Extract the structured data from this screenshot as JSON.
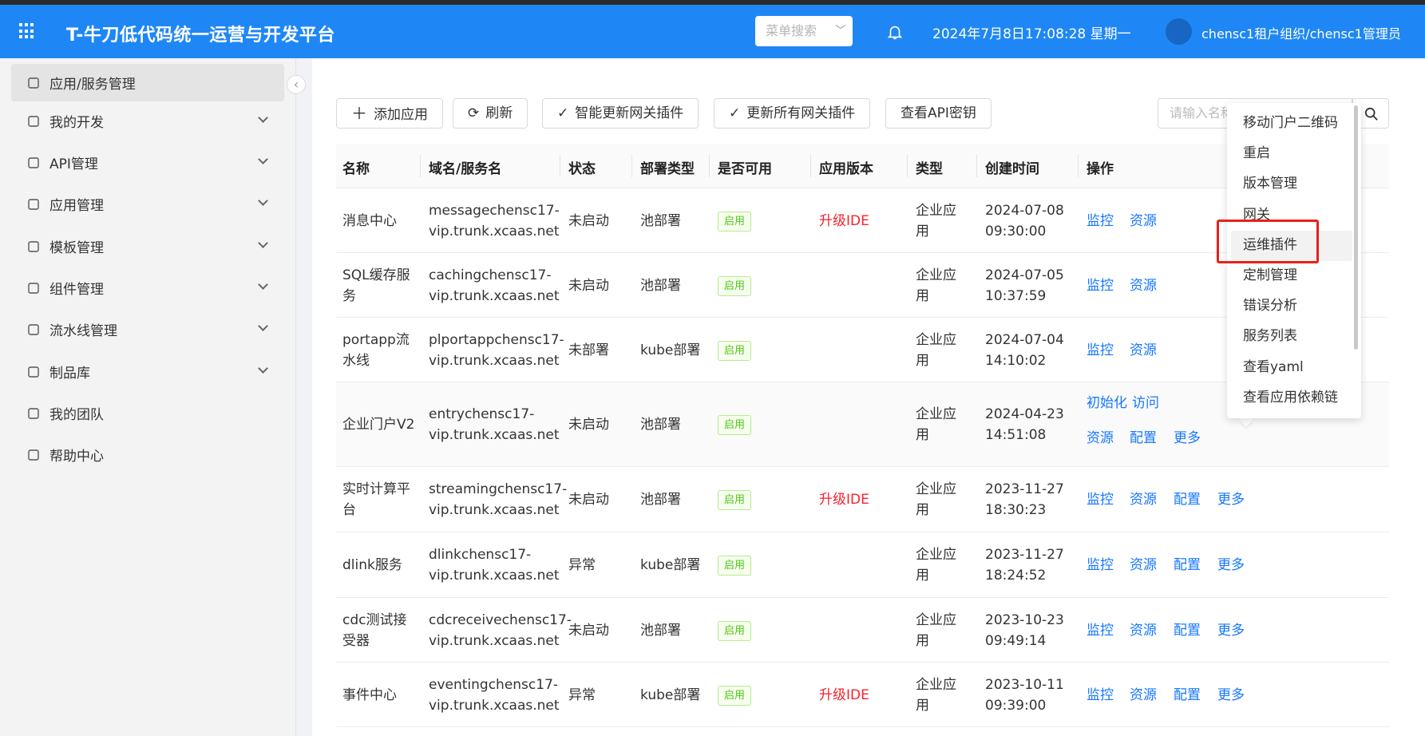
{
  "header": {
    "title": "T-牛刀低代码统一运营与开发平台",
    "menu_search": "菜单搜索",
    "datetime": "2024年7月8日17:08:28 星期一",
    "user": "chensc1租户组织/chensc1管理员"
  },
  "sidebar": {
    "items": [
      {
        "label": "应用/服务管理",
        "icon": "app-service-icon"
      },
      {
        "label": "我的开发",
        "icon": "dev-icon"
      },
      {
        "label": "API管理",
        "icon": "api-icon"
      },
      {
        "label": "应用管理",
        "icon": "grid-icon"
      },
      {
        "label": "模板管理",
        "icon": "template-icon"
      },
      {
        "label": "组件管理",
        "icon": "component-icon"
      },
      {
        "label": "流水线管理",
        "icon": "folder-icon"
      },
      {
        "label": "制品库",
        "icon": "folder-icon"
      },
      {
        "label": "我的团队",
        "icon": "team-icon"
      },
      {
        "label": "帮助中心",
        "icon": "help-icon"
      }
    ]
  },
  "toolbar": {
    "add": "添加应用",
    "refresh": "刷新",
    "smart_update": "智能更新网关插件",
    "update_all": "更新所有网关插件",
    "view_api_key": "查看API密钥",
    "search_placeholder": "请输入名称"
  },
  "table": {
    "headers": [
      "名称",
      "域名/服务名",
      "状态",
      "部署类型",
      "是否可用",
      "应用版本",
      "类型",
      "创建时间",
      "操作"
    ],
    "rows": [
      {
        "name": [
          "消息中心"
        ],
        "domain": [
          "messagechensc17-",
          "vip.trunk.xcaas.net"
        ],
        "status": "未启动",
        "deploy": "池部署",
        "avail": "启用",
        "version": "升级IDE",
        "type": [
          "企业应",
          "用"
        ],
        "created": [
          "2024-07-08",
          "09:30:00"
        ],
        "ops": [
          "监控",
          "资源"
        ]
      },
      {
        "name": [
          "SQL缓存服",
          "务"
        ],
        "domain": [
          "cachingchensc17-",
          "vip.trunk.xcaas.net"
        ],
        "status": "未启动",
        "deploy": "池部署",
        "avail": "启用",
        "version": "",
        "type": [
          "企业应",
          "用"
        ],
        "created": [
          "2024-07-05",
          "10:37:59"
        ],
        "ops": [
          "监控",
          "资源"
        ]
      },
      {
        "name": [
          "portapp流",
          "水线"
        ],
        "domain": [
          "plportappchensc17-",
          "vip.trunk.xcaas.net"
        ],
        "status": "未部署",
        "deploy": "kube部署",
        "avail": "启用",
        "version": "",
        "type": [
          "企业应",
          "用"
        ],
        "created": [
          "2024-07-04",
          "14:10:02"
        ],
        "ops": [
          "监控",
          "资源"
        ]
      },
      {
        "name": [
          "企业门户V2"
        ],
        "domain": [
          "entrychensc17-",
          "vip.trunk.xcaas.net"
        ],
        "status": "未启动",
        "deploy": "池部署",
        "avail": "启用",
        "version": "",
        "type": [
          "企业应",
          "用"
        ],
        "created": [
          "2024-04-23",
          "14:51:08"
        ],
        "ops": [
          "初始化",
          "访问",
          "资源",
          "配置",
          "更多"
        ]
      },
      {
        "name": [
          "实时计算平",
          "台"
        ],
        "domain": [
          "streamingchensc17-",
          "vip.trunk.xcaas.net"
        ],
        "status": "未启动",
        "deploy": "池部署",
        "avail": "启用",
        "version": "升级IDE",
        "type": [
          "企业应",
          "用"
        ],
        "created": [
          "2023-11-27",
          "18:30:23"
        ],
        "ops": [
          "监控",
          "资源",
          "配置",
          "更多"
        ]
      },
      {
        "name": [
          "dlink服务"
        ],
        "domain": [
          "dlinkchensc17-",
          "vip.trunk.xcaas.net"
        ],
        "status": "异常",
        "deploy": "kube部署",
        "avail": "启用",
        "version": "",
        "type": [
          "企业应",
          "用"
        ],
        "created": [
          "2023-11-27",
          "18:24:52"
        ],
        "ops": [
          "监控",
          "资源",
          "配置",
          "更多"
        ]
      },
      {
        "name": [
          "cdc测试接",
          "受器"
        ],
        "domain": [
          "cdcreceivechensc17-",
          "vip.trunk.xcaas.net"
        ],
        "status": "未启动",
        "deploy": "池部署",
        "avail": "启用",
        "version": "",
        "type": [
          "企业应",
          "用"
        ],
        "created": [
          "2023-10-23",
          "09:49:14"
        ],
        "ops": [
          "监控",
          "资源",
          "配置",
          "更多"
        ]
      },
      {
        "name": [
          "事件中心"
        ],
        "domain": [
          "eventingchensc17-",
          "vip.trunk.xcaas.net"
        ],
        "status": "异常",
        "deploy": "kube部署",
        "avail": "启用",
        "version": "升级IDE",
        "type": [
          "企业应",
          "用"
        ],
        "created": [
          "2023-10-11",
          "09:39:00"
        ],
        "ops": [
          "监控",
          "资源",
          "配置",
          "更多"
        ]
      }
    ]
  },
  "dropdown": {
    "items": [
      "移动门户二维码",
      "重启",
      "版本管理",
      "网关",
      "运维插件",
      "定制管理",
      "错误分析",
      "服务列表",
      "查看yaml",
      "查看应用依赖链"
    ],
    "hovered": "运维插件"
  },
  "colors": {
    "header": "#1f87f5",
    "link": "#1677ff",
    "danger": "#f5222d",
    "tag_green": "#52c41a",
    "highlight_box": "#e8211a"
  }
}
